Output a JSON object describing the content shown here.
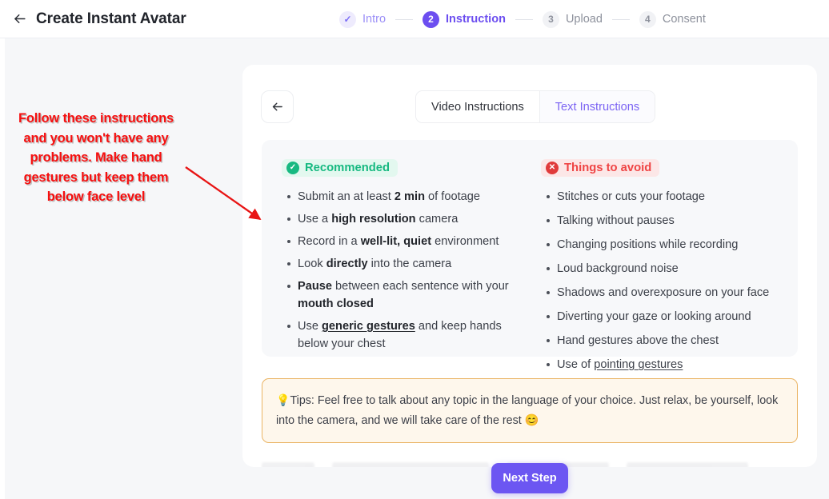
{
  "header": {
    "back_icon": "arrow-left-icon",
    "title": "Create Instant Avatar",
    "steps": [
      {
        "badge": "✓",
        "label": "Intro",
        "state": "done"
      },
      {
        "badge": "2",
        "label": "Instruction",
        "state": "active"
      },
      {
        "badge": "3",
        "label": "Upload",
        "state": "todo"
      },
      {
        "badge": "4",
        "label": "Consent",
        "state": "todo"
      }
    ]
  },
  "card": {
    "back_button_icon": "arrow-left-icon",
    "tabs": [
      {
        "label": "Video Instructions",
        "active": false
      },
      {
        "label": "Text Instructions",
        "active": true
      }
    ],
    "recommended": {
      "badge_label": "Recommended",
      "badge_icon": "check-circle-icon",
      "items": [
        "Submit an at least <b>2 min</b> of footage",
        "Use a <b>high resolution</b> camera",
        "Record in a <b>well-lit, quiet</b> environment",
        "Look <b>directly</b> into the camera",
        "<b>Pause</b> between each sentence with your <b>mouth closed</b>",
        "Use <b><u>generic gestures</u></b> and keep hands below your chest"
      ]
    },
    "avoid": {
      "badge_label": "Things to avoid",
      "badge_icon": "x-circle-icon",
      "items": [
        "Stitches or cuts your footage",
        "Talking without pauses",
        "Changing positions while recording",
        "Loud background noise",
        "Shadows and overexposure on your face",
        "Diverting your gaze or looking around",
        "Hand gestures above the chest",
        "Use of <u>pointing gestures</u>"
      ]
    },
    "tips": {
      "icon": "lightbulb-icon",
      "text": "Tips: Feel free to talk about any topic in the language of your choice. Just relax, be yourself, look into the camera, and we will take care of the rest 😊"
    }
  },
  "footer": {
    "next_label": "Next Step"
  },
  "annotation": {
    "text": "Follow these instructions and you won't have any problems.  Make hand gestures but keep them below face level",
    "color": "#f60f0f",
    "arrow": "red-arrow-annotation"
  },
  "colors": {
    "accent": "#6c4ef0",
    "page_bg": "#f6f7f9",
    "panel_bg": "#f7f8fa",
    "ok": "#17b981",
    "bad": "#ef4444",
    "tips_bg": "#fef7ec",
    "tips_border": "#eab464"
  }
}
